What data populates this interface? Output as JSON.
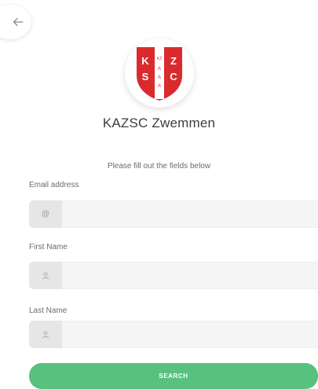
{
  "header": {
    "back_icon": "arrow-left-icon"
  },
  "logo": {
    "letters": [
      "K",
      "Z",
      "S",
      "C"
    ],
    "center_text": "KZ A·A·A",
    "colors": {
      "shield": "#d92a2e",
      "band": "#ffffff"
    }
  },
  "title": "KAZSC Zwemmen",
  "subtitle": "Please fill out the fields below",
  "form": {
    "email": {
      "label": "Email address",
      "icon": "@",
      "value": ""
    },
    "first_name": {
      "label": "First Name",
      "icon": "user-icon",
      "value": ""
    },
    "last_name": {
      "label": "Last Name",
      "icon": "user-icon",
      "value": ""
    }
  },
  "search_button": {
    "label": "SEARCH",
    "color": "#58c17f"
  }
}
